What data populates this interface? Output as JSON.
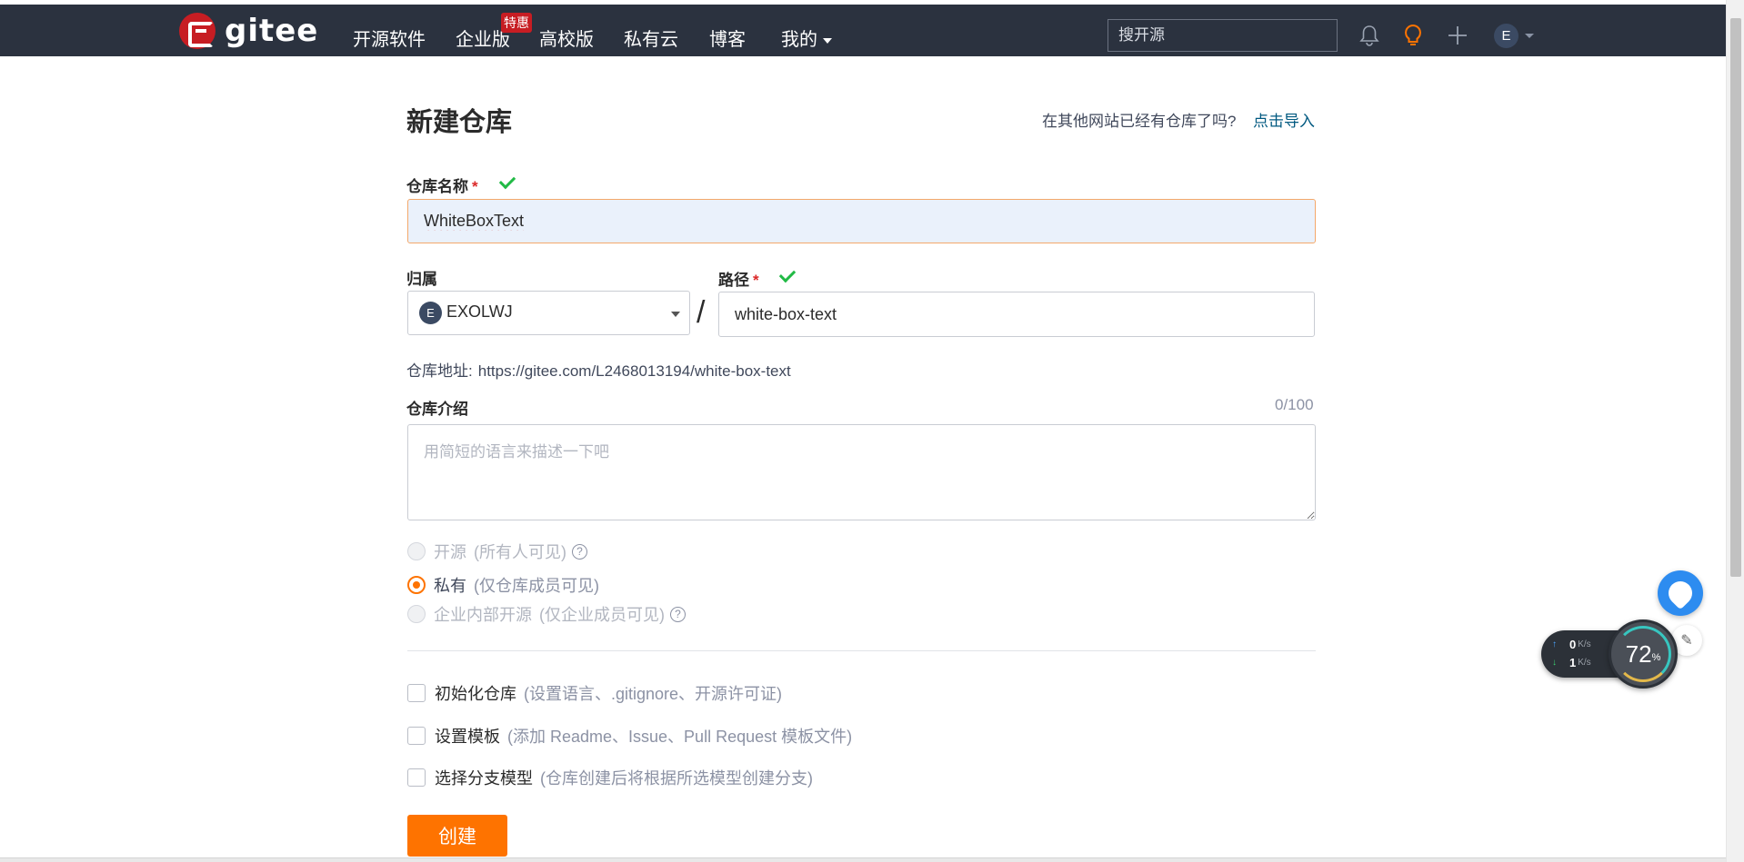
{
  "navbar": {
    "logo_text": "gitee",
    "items": [
      "开源软件",
      "企业版",
      "高校版",
      "私有云",
      "博客",
      "我的"
    ],
    "enterprise_badge": "特惠",
    "search_placeholder": "搜开源",
    "user_initial": "E",
    "accent": "#c71d23",
    "background": "#2b323f"
  },
  "page": {
    "title": "新建仓库",
    "import_hint": "在其他网站已经有仓库了吗?",
    "import_link": "点击导入"
  },
  "form": {
    "name_label": "仓库名称",
    "required_mark": "*",
    "name_value": "WhiteBoxText",
    "owner_label": "归属",
    "owner_initial": "E",
    "owner_value": "EXOLWJ",
    "path_separator": "/",
    "path_label": "路径",
    "path_value": "white-box-text",
    "address_label": "仓库地址:",
    "address_value": "https://gitee.com/L2468013194/white-box-text",
    "desc_label": "仓库介绍",
    "desc_count": "0/100",
    "desc_placeholder": "用简短的语言来描述一下吧",
    "visibility": [
      {
        "label": "开源",
        "note": "(所有人可见)",
        "selected": false,
        "disabled": true,
        "help": "?"
      },
      {
        "label": "私有",
        "note": "(仅仓库成员可见)",
        "selected": true,
        "disabled": false
      },
      {
        "label": "企业内部开源",
        "note": "(仅企业成员可见)",
        "selected": false,
        "disabled": true,
        "help": "?"
      }
    ],
    "options": [
      {
        "label": "初始化仓库",
        "note": "(设置语言、.gitignore、开源许可证)",
        "checked": false
      },
      {
        "label": "设置模板",
        "note": "(添加 Readme、Issue、Pull Request 模板文件)",
        "checked": false
      },
      {
        "label": "选择分支模型",
        "note": "(仓库创建后将根据所选模型创建分支)",
        "checked": false
      }
    ],
    "submit_label": "创建",
    "submit_color": "#fe7300"
  },
  "net_monitor": {
    "upload": "0",
    "download": "1",
    "unit": "K/s",
    "usage": "72",
    "usage_unit": "%"
  }
}
